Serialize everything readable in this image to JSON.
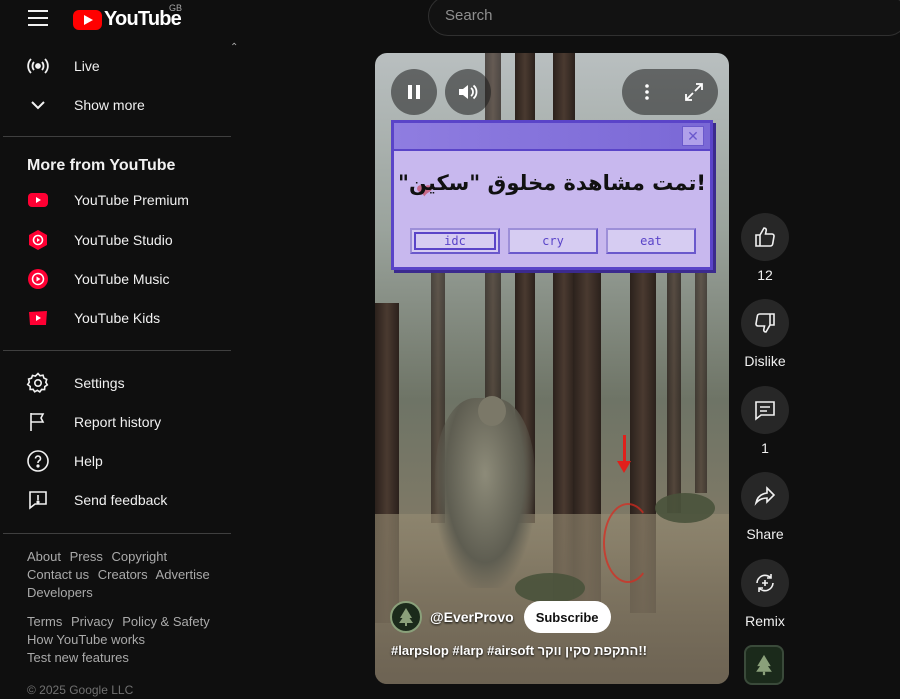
{
  "header": {
    "logo_text": "YouTube",
    "country": "GB",
    "search_placeholder": "Search"
  },
  "sidebar": {
    "top_items": [
      {
        "label": "Live",
        "icon": "live-icon"
      },
      {
        "label": "Show more",
        "icon": "chevron-down-icon"
      }
    ],
    "more_title": "More from YouTube",
    "more_items": [
      {
        "label": "YouTube Premium",
        "icon": "youtube-premium-icon"
      },
      {
        "label": "YouTube Studio",
        "icon": "youtube-studio-icon"
      },
      {
        "label": "YouTube Music",
        "icon": "youtube-music-icon"
      },
      {
        "label": "YouTube Kids",
        "icon": "youtube-kids-icon"
      }
    ],
    "settings_items": [
      {
        "label": "Settings",
        "icon": "gear-icon"
      },
      {
        "label": "Report history",
        "icon": "flag-icon"
      },
      {
        "label": "Help",
        "icon": "help-icon"
      },
      {
        "label": "Send feedback",
        "icon": "feedback-icon"
      }
    ],
    "footer_links_1": [
      "About",
      "Press",
      "Copyright",
      "Contact us",
      "Creators",
      "Advertise",
      "Developers"
    ],
    "footer_links_2": [
      "Terms",
      "Privacy",
      "Policy & Safety",
      "How YouTube works",
      "Test new features"
    ],
    "copyright": "© 2025 Google LLC"
  },
  "video": {
    "dialog_message": "!تمت مشاهدة مخلوق \"سكين\"",
    "dialog_buttons": [
      "idc",
      "cry",
      "eat"
    ],
    "channel_name": "@EverProvo",
    "subscribe_label": "Subscribe",
    "caption": "#larpslop #larp #airsoft התקפת סקין ווקר!!"
  },
  "actions": {
    "like_count": "12",
    "dislike_label": "Dislike",
    "comment_count": "1",
    "share_label": "Share",
    "remix_label": "Remix"
  },
  "colors": {
    "brand_red": "#ff0000",
    "background": "#0f0f0f",
    "dialog_purple": "#5a44c8"
  }
}
